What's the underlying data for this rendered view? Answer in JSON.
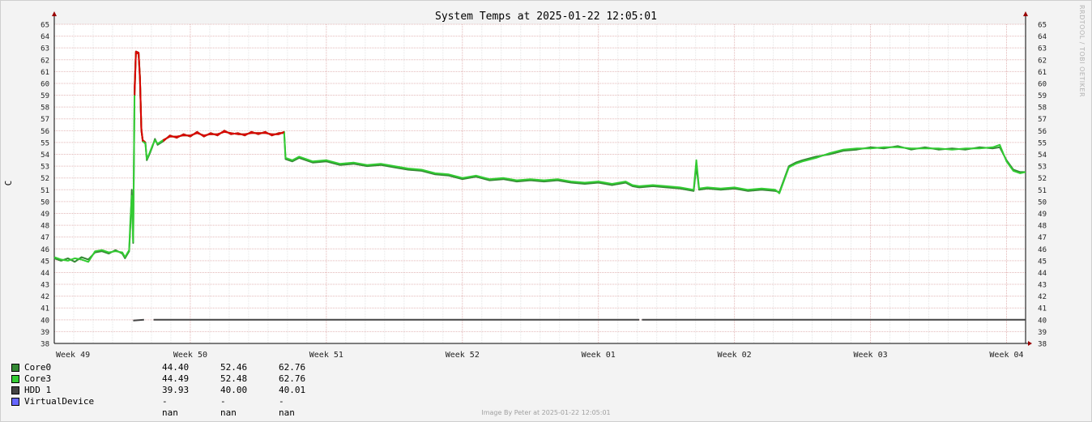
{
  "chart_data": {
    "type": "line",
    "title": "System Temps at 2025-01-22 12:05:01",
    "ylabel": "C",
    "xlabel": "",
    "ylim": [
      38,
      65
    ],
    "y_ticks": [
      38,
      39,
      40,
      41,
      42,
      43,
      44,
      45,
      46,
      47,
      48,
      49,
      50,
      51,
      52,
      53,
      54,
      55,
      56,
      57,
      58,
      59,
      60,
      61,
      62,
      63,
      64,
      65
    ],
    "x_ticks": [
      "Week 49",
      "Week 50",
      "Week 51",
      "Week 52",
      "Week 01",
      "Week 02",
      "Week 03",
      "Week 04"
    ],
    "x_range_weeks": [
      0,
      7.14
    ],
    "threshold": 55,
    "grid": true,
    "series": [
      {
        "name": "Core0",
        "color": "#338833",
        "hot_color": "#dd0000",
        "stats": {
          "cur": "44.40",
          "avg": "52.46",
          "max": "62.76"
        },
        "points": [
          [
            0,
            45.2
          ],
          [
            0.05,
            45.0
          ],
          [
            0.1,
            45.2
          ],
          [
            0.15,
            44.9
          ],
          [
            0.2,
            45.3
          ],
          [
            0.25,
            45.1
          ],
          [
            0.3,
            45.7
          ],
          [
            0.35,
            45.8
          ],
          [
            0.4,
            45.6
          ],
          [
            0.45,
            45.9
          ],
          [
            0.5,
            45.6
          ],
          [
            0.52,
            45.2
          ],
          [
            0.55,
            45.8
          ],
          [
            0.56,
            48.0
          ],
          [
            0.57,
            51.0
          ],
          [
            0.58,
            46.5
          ],
          [
            0.59,
            59.5
          ],
          [
            0.6,
            62.7
          ],
          [
            0.62,
            62.6
          ],
          [
            0.63,
            60.5
          ],
          [
            0.64,
            56.0
          ],
          [
            0.65,
            55.2
          ],
          [
            0.67,
            55.0
          ],
          [
            0.68,
            53.5
          ],
          [
            0.7,
            54.0
          ],
          [
            0.72,
            54.6
          ],
          [
            0.74,
            55.3
          ],
          [
            0.76,
            54.8
          ],
          [
            0.8,
            55.1
          ],
          [
            0.85,
            55.6
          ],
          [
            0.9,
            55.4
          ],
          [
            0.95,
            55.7
          ],
          [
            1.0,
            55.5
          ],
          [
            1.05,
            55.9
          ],
          [
            1.1,
            55.5
          ],
          [
            1.15,
            55.8
          ],
          [
            1.2,
            55.6
          ],
          [
            1.25,
            56.0
          ],
          [
            1.3,
            55.7
          ],
          [
            1.35,
            55.8
          ],
          [
            1.4,
            55.6
          ],
          [
            1.45,
            55.9
          ],
          [
            1.5,
            55.7
          ],
          [
            1.55,
            55.9
          ],
          [
            1.6,
            55.6
          ],
          [
            1.65,
            55.8
          ],
          [
            1.69,
            55.8
          ],
          [
            1.7,
            53.6
          ],
          [
            1.75,
            53.4
          ],
          [
            1.8,
            53.7
          ],
          [
            1.9,
            53.3
          ],
          [
            2.0,
            53.4
          ],
          [
            2.1,
            53.1
          ],
          [
            2.2,
            53.2
          ],
          [
            2.3,
            53.0
          ],
          [
            2.4,
            53.1
          ],
          [
            2.5,
            52.9
          ],
          [
            2.6,
            52.7
          ],
          [
            2.7,
            52.6
          ],
          [
            2.8,
            52.3
          ],
          [
            2.9,
            52.2
          ],
          [
            3.0,
            51.9
          ],
          [
            3.1,
            52.1
          ],
          [
            3.2,
            51.8
          ],
          [
            3.3,
            51.9
          ],
          [
            3.4,
            51.7
          ],
          [
            3.5,
            51.8
          ],
          [
            3.6,
            51.7
          ],
          [
            3.7,
            51.8
          ],
          [
            3.8,
            51.6
          ],
          [
            3.9,
            51.5
          ],
          [
            4.0,
            51.6
          ],
          [
            4.1,
            51.4
          ],
          [
            4.2,
            51.6
          ],
          [
            4.25,
            51.3
          ],
          [
            4.3,
            51.2
          ],
          [
            4.4,
            51.3
          ],
          [
            4.5,
            51.2
          ],
          [
            4.6,
            51.1
          ],
          [
            4.65,
            51.0
          ],
          [
            4.7,
            50.9
          ],
          [
            4.72,
            53.0
          ],
          [
            4.74,
            51.0
          ],
          [
            4.8,
            51.1
          ],
          [
            4.9,
            51.0
          ],
          [
            5.0,
            51.1
          ],
          [
            5.1,
            50.9
          ],
          [
            5.2,
            51.0
          ],
          [
            5.3,
            50.9
          ],
          [
            5.33,
            50.8
          ],
          [
            5.4,
            53.0
          ],
          [
            5.45,
            53.3
          ],
          [
            5.5,
            53.5
          ],
          [
            5.6,
            53.8
          ],
          [
            5.7,
            54.0
          ],
          [
            5.8,
            54.3
          ],
          [
            5.9,
            54.4
          ],
          [
            6.0,
            54.6
          ],
          [
            6.1,
            54.5
          ],
          [
            6.2,
            54.7
          ],
          [
            6.3,
            54.4
          ],
          [
            6.4,
            54.6
          ],
          [
            6.5,
            54.4
          ],
          [
            6.6,
            54.5
          ],
          [
            6.7,
            54.4
          ],
          [
            6.8,
            54.6
          ],
          [
            6.9,
            54.5
          ],
          [
            6.95,
            54.6
          ],
          [
            7.0,
            53.5
          ],
          [
            7.05,
            52.7
          ],
          [
            7.1,
            52.5
          ],
          [
            7.14,
            52.5
          ]
        ]
      },
      {
        "name": "Core3",
        "color": "#33cc33",
        "hot_color": "#dd0000",
        "stats": {
          "cur": "44.49",
          "avg": "52.48",
          "max": "62.76"
        },
        "points": [
          [
            0,
            45.3
          ],
          [
            0.05,
            45.1
          ],
          [
            0.1,
            45.0
          ],
          [
            0.15,
            45.2
          ],
          [
            0.2,
            45.1
          ],
          [
            0.25,
            44.9
          ],
          [
            0.3,
            45.8
          ],
          [
            0.35,
            45.9
          ],
          [
            0.4,
            45.7
          ],
          [
            0.45,
            45.8
          ],
          [
            0.5,
            45.7
          ],
          [
            0.52,
            45.3
          ],
          [
            0.55,
            45.9
          ],
          [
            0.56,
            48.5
          ],
          [
            0.57,
            50.5
          ],
          [
            0.58,
            46.6
          ],
          [
            0.59,
            59.0
          ],
          [
            0.6,
            62.6
          ],
          [
            0.62,
            62.5
          ],
          [
            0.63,
            60.3
          ],
          [
            0.64,
            56.2
          ],
          [
            0.65,
            55.1
          ],
          [
            0.67,
            54.9
          ],
          [
            0.68,
            53.6
          ],
          [
            0.7,
            54.1
          ],
          [
            0.72,
            54.7
          ],
          [
            0.74,
            55.2
          ],
          [
            0.76,
            54.9
          ],
          [
            0.8,
            55.2
          ],
          [
            0.85,
            55.5
          ],
          [
            0.9,
            55.5
          ],
          [
            0.95,
            55.6
          ],
          [
            1.0,
            55.6
          ],
          [
            1.05,
            55.8
          ],
          [
            1.1,
            55.6
          ],
          [
            1.15,
            55.7
          ],
          [
            1.2,
            55.7
          ],
          [
            1.25,
            55.9
          ],
          [
            1.3,
            55.8
          ],
          [
            1.35,
            55.7
          ],
          [
            1.4,
            55.7
          ],
          [
            1.45,
            55.8
          ],
          [
            1.5,
            55.8
          ],
          [
            1.55,
            55.8
          ],
          [
            1.6,
            55.7
          ],
          [
            1.65,
            55.7
          ],
          [
            1.69,
            55.9
          ],
          [
            1.7,
            53.7
          ],
          [
            1.75,
            53.5
          ],
          [
            1.8,
            53.8
          ],
          [
            1.9,
            53.4
          ],
          [
            2.0,
            53.5
          ],
          [
            2.1,
            53.2
          ],
          [
            2.2,
            53.3
          ],
          [
            2.3,
            53.1
          ],
          [
            2.4,
            53.2
          ],
          [
            2.5,
            53.0
          ],
          [
            2.6,
            52.8
          ],
          [
            2.7,
            52.7
          ],
          [
            2.8,
            52.4
          ],
          [
            2.9,
            52.3
          ],
          [
            3.0,
            52.0
          ],
          [
            3.1,
            52.2
          ],
          [
            3.2,
            51.9
          ],
          [
            3.3,
            52.0
          ],
          [
            3.4,
            51.8
          ],
          [
            3.5,
            51.9
          ],
          [
            3.6,
            51.8
          ],
          [
            3.7,
            51.9
          ],
          [
            3.8,
            51.7
          ],
          [
            3.9,
            51.6
          ],
          [
            4.0,
            51.7
          ],
          [
            4.1,
            51.5
          ],
          [
            4.2,
            51.7
          ],
          [
            4.25,
            51.4
          ],
          [
            4.3,
            51.3
          ],
          [
            4.4,
            51.4
          ],
          [
            4.5,
            51.3
          ],
          [
            4.6,
            51.2
          ],
          [
            4.65,
            51.1
          ],
          [
            4.7,
            51.0
          ],
          [
            4.72,
            53.5
          ],
          [
            4.74,
            51.1
          ],
          [
            4.8,
            51.2
          ],
          [
            4.9,
            51.1
          ],
          [
            5.0,
            51.2
          ],
          [
            5.1,
            51.0
          ],
          [
            5.2,
            51.1
          ],
          [
            5.3,
            51.0
          ],
          [
            5.33,
            50.7
          ],
          [
            5.4,
            52.9
          ],
          [
            5.45,
            53.2
          ],
          [
            5.5,
            53.4
          ],
          [
            5.6,
            53.7
          ],
          [
            5.7,
            54.1
          ],
          [
            5.8,
            54.4
          ],
          [
            5.9,
            54.5
          ],
          [
            6.0,
            54.5
          ],
          [
            6.1,
            54.6
          ],
          [
            6.2,
            54.6
          ],
          [
            6.3,
            54.5
          ],
          [
            6.4,
            54.5
          ],
          [
            6.5,
            54.5
          ],
          [
            6.6,
            54.4
          ],
          [
            6.7,
            54.5
          ],
          [
            6.8,
            54.5
          ],
          [
            6.9,
            54.6
          ],
          [
            6.95,
            54.8
          ],
          [
            7.0,
            53.4
          ],
          [
            7.05,
            52.6
          ],
          [
            7.1,
            52.4
          ],
          [
            7.14,
            52.5
          ]
        ]
      },
      {
        "name": "HDD 1",
        "color": "#444444",
        "stats": {
          "cur": "39.93",
          "avg": "40.00",
          "max": "40.01"
        },
        "segments": [
          [
            [
              0.58,
              39.93
            ],
            [
              0.66,
              40.0
            ]
          ],
          [
            [
              0.73,
              40.0
            ],
            [
              4.3,
              40.0
            ]
          ],
          [
            [
              4.32,
              40.0
            ],
            [
              7.14,
              40.0
            ]
          ]
        ]
      },
      {
        "name": "VirtualDevice",
        "color": "#6666ff",
        "stats": {
          "cur": "-nan",
          "avg": "-nan",
          "max": "-nan"
        },
        "points": []
      }
    ]
  },
  "footer_text": "Image By Peter at 2025-01-22 12:05:01",
  "credit_text": "RRDTOOL / TOBI OETIKER"
}
